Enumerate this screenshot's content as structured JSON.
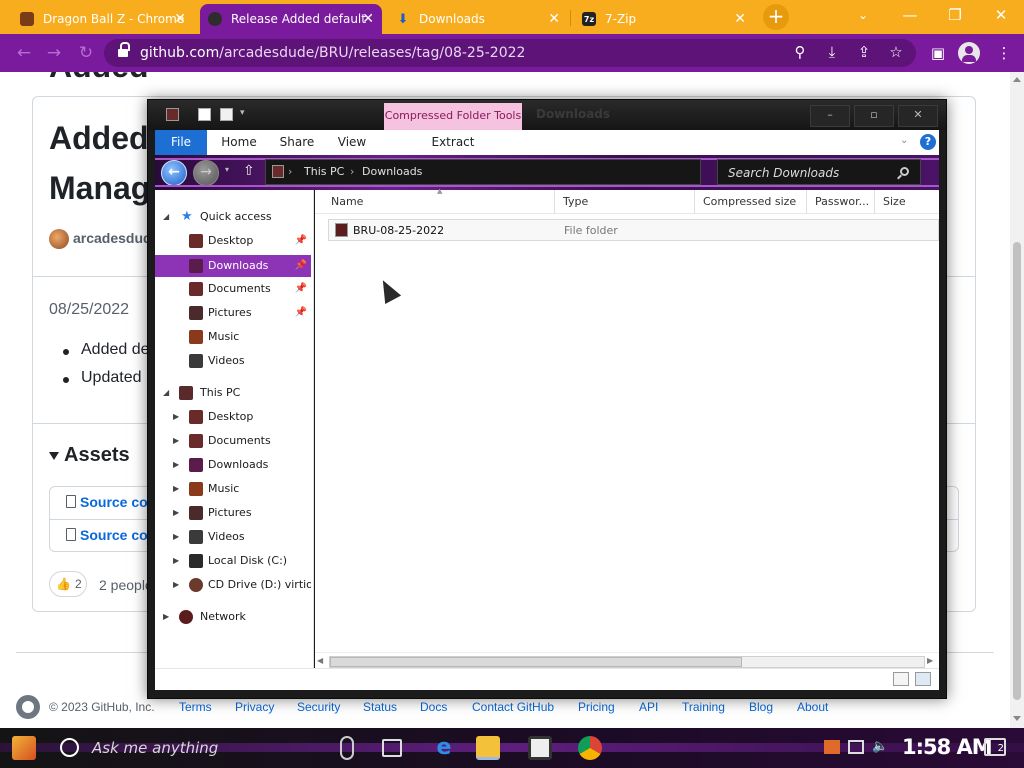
{
  "browser": {
    "tabs": [
      {
        "title": "Dragon Ball Z - Chrome",
        "active": false
      },
      {
        "title": "Release Added default",
        "active": true
      },
      {
        "title": "Downloads",
        "active": false
      },
      {
        "title": "7-Zip",
        "active": false
      }
    ],
    "tab_close_glyph": "✕",
    "new_tab_glyph": "+",
    "url_host": "github.com",
    "url_path": "/arcadesdude/BRU/releases/tag/08-25-2022",
    "window_controls": {
      "minimize": "—",
      "maximize": "❐",
      "close": "✕"
    },
    "colors": {
      "tabstrip": "#f7ad1e",
      "active_tab": "#7a1a9d",
      "toolbar": "#7a1a9d"
    }
  },
  "github": {
    "title_line1": "Added",
    "title_line2": "Manag",
    "author": "arcadesdude",
    "date": "08/25/2022",
    "bullets": [
      "Added de",
      "Updated"
    ],
    "assets_heading": "Assets",
    "assets": [
      "Source co",
      "Source co"
    ],
    "reaction_count": "2",
    "reaction_text": "2 people",
    "footer_copy": "© 2023 GitHub, Inc.",
    "footer_links": [
      "Terms",
      "Privacy",
      "Security",
      "Status",
      "Docs",
      "Contact GitHub",
      "Pricing",
      "API",
      "Training",
      "Blog",
      "About"
    ]
  },
  "explorer": {
    "context_tab": "Compressed Folder Tools",
    "title": "Downloads",
    "ribbon_tabs": [
      "File",
      "Home",
      "Share",
      "View",
      "Extract"
    ],
    "breadcrumb": [
      "This PC",
      "Downloads"
    ],
    "search_placeholder": "Search Downloads",
    "nav": {
      "quick_access": "Quick access",
      "quick_items": [
        {
          "label": "Desktop",
          "pinned": true
        },
        {
          "label": "Downloads",
          "pinned": true,
          "selected": true
        },
        {
          "label": "Documents",
          "pinned": true
        },
        {
          "label": "Pictures",
          "pinned": true
        },
        {
          "label": "Music",
          "pinned": false
        },
        {
          "label": "Videos",
          "pinned": false
        }
      ],
      "this_pc": "This PC",
      "pc_items": [
        "Desktop",
        "Documents",
        "Downloads",
        "Music",
        "Pictures",
        "Videos",
        "Local Disk (C:)",
        "CD Drive (D:) virtio-"
      ],
      "network": "Network"
    },
    "columns": [
      "Name",
      "Type",
      "Compressed size",
      "Passwor...",
      "Size"
    ],
    "rows": [
      {
        "name": "BRU-08-25-2022",
        "type": "File folder"
      }
    ]
  },
  "taskbar": {
    "search_prompt": "Ask me anything",
    "time": "1:58 AM",
    "notification_count": "2"
  }
}
